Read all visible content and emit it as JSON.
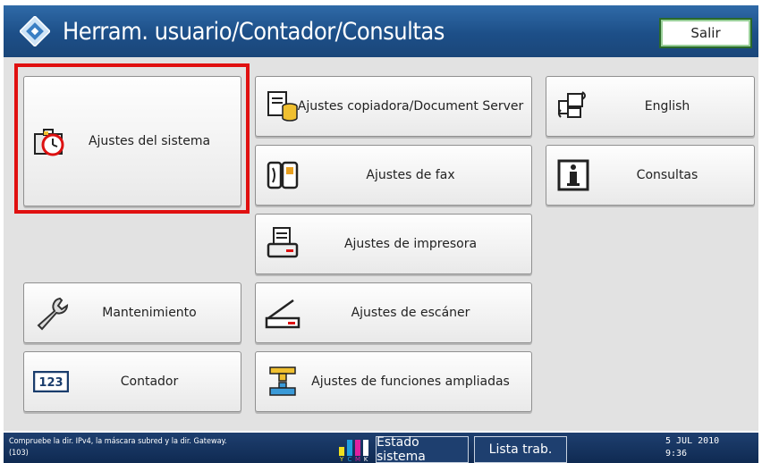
{
  "header": {
    "title": "Herram. usuario/Contador/Consultas",
    "exit_label": "Salir"
  },
  "buttons": {
    "system_settings": "Ajustes del sistema",
    "copier_settings": "Ajustes copiadora/Document Server",
    "english": "English",
    "fax_settings": "Ajustes de fax",
    "inquiry": "Consultas",
    "printer_settings": "Ajustes de impresora",
    "maintenance": "Mantenimiento",
    "scanner_settings": "Ajustes de escáner",
    "counter": "Contador",
    "counter_icon_text": "123",
    "extended_settings": "Ajustes de funciones ampliadas"
  },
  "statusbar": {
    "message_line1": "Compruebe la dir. IPv4, la máscara subred y la dir. Gateway.",
    "message_line2": "(103)",
    "system_status": "Estado sistema",
    "job_list": "Lista trab.",
    "date": "5 JUL  2010",
    "time": "9:36",
    "toner_letters": [
      "Y",
      "C",
      "M",
      "K"
    ]
  },
  "colors": {
    "title_bar": "#1d4f88",
    "highlight": "#e01010",
    "panel_bg": "#e2e2e2",
    "status_bar": "#0f2a52"
  }
}
